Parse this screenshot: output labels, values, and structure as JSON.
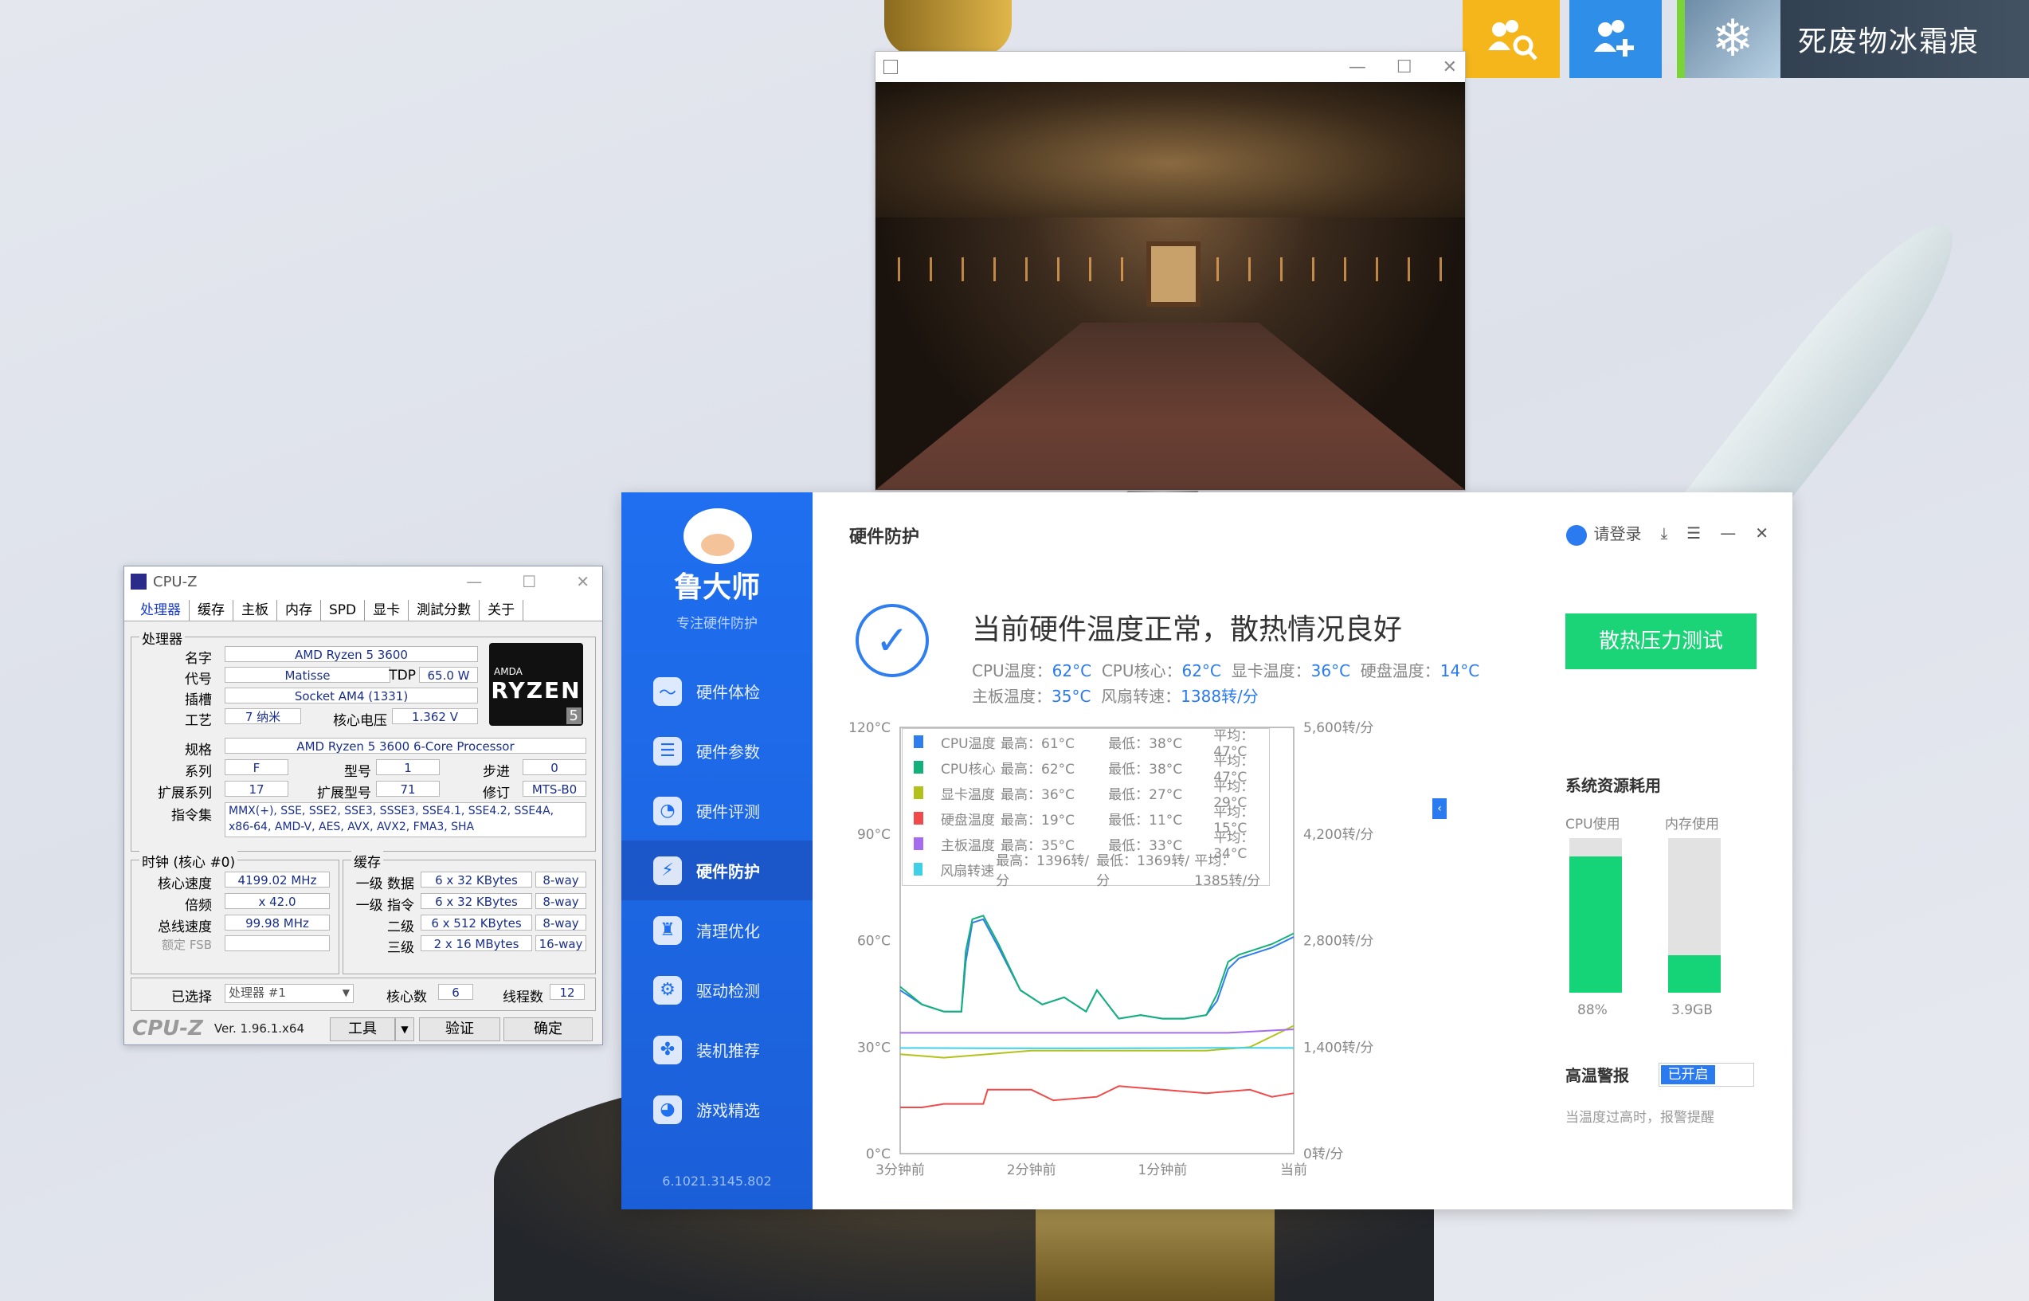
{
  "desktop": {
    "game_tile_title": "死废物冰霜痕"
  },
  "cpuz": {
    "title": "CPU-Z",
    "tabs": [
      "处理器",
      "缓存",
      "主板",
      "内存",
      "SPD",
      "显卡",
      "測試分數",
      "关于"
    ],
    "processor_group": "处理器",
    "name_label": "名字",
    "name": "AMD Ryzen 5 3600",
    "codename_label": "代号",
    "codename": "Matisse",
    "tdp_label": "TDP",
    "tdp": "65.0 W",
    "socket_label": "插槽",
    "socket": "Socket AM4 (1331)",
    "process_label": "工艺",
    "process": "7 纳米",
    "vcore_label": "核心电压",
    "vcore": "1.362 V",
    "spec_label": "规格",
    "spec": "AMD Ryzen 5 3600 6-Core Processor",
    "family_label": "系列",
    "family": "F",
    "model_label": "型号",
    "model": "1",
    "stepping_label": "步进",
    "stepping": "0",
    "extfamily_label": "扩展系列",
    "extfamily": "17",
    "extmodel_label": "扩展型号",
    "extmodel": "71",
    "revision_label": "修订",
    "revision": "MTS-B0",
    "instr_label": "指令集",
    "instr_line1": "MMX(+), SSE, SSE2, SSE3, SSSE3, SSE4.1, SSE4.2, SSE4A,",
    "instr_line2": "x86-64, AMD-V, AES, AVX, AVX2, FMA3, SHA",
    "logo_amd": "AMDA",
    "logo_ryzen": "RYZEN",
    "logo_five": "5",
    "clocks_group": "时钟 (核心 #0)",
    "core_speed_label": "核心速度",
    "core_speed": "4199.02 MHz",
    "multiplier_label": "倍频",
    "multiplier": "x 42.0",
    "bus_speed_label": "总线速度",
    "bus_speed": "99.98 MHz",
    "rated_fsb_label": "额定 FSB",
    "cache_group": "缓存",
    "l1d_label": "一级 数据",
    "l1d": "6 x 32 KBytes",
    "l1d_way": "8-way",
    "l1i_label": "一级 指令",
    "l1i": "6 x 32 KBytes",
    "l1i_way": "8-way",
    "l2_label": "二级",
    "l2": "6 x 512 KBytes",
    "l2_way": "8-way",
    "l3_label": "三级",
    "l3": "2 x 16 MBytes",
    "l3_way": "16-way",
    "selected_label": "已选择",
    "selected": "处理器 #1",
    "cores_label": "核心数",
    "cores": "6",
    "threads_label": "线程数",
    "threads": "12",
    "brand": "CPU-Z",
    "version": "Ver. 1.96.1.x64",
    "tools_button": "工具",
    "validate_button": "验证",
    "ok_button": "确定"
  },
  "ludashi": {
    "brand": "鲁大师",
    "slogan": "专注硬件防护",
    "nav": [
      "硬件体检",
      "硬件参数",
      "硬件评测",
      "硬件防护",
      "清理优化",
      "驱动检测",
      "装机推荐",
      "游戏精选"
    ],
    "active_nav": "硬件防护",
    "version": "6.1021.3145.802",
    "header": "硬件防护",
    "login": "请登录",
    "status": "当前硬件温度正常，散热情况良好",
    "temps_line1": [
      {
        "label": "CPU温度：",
        "value": "62°C"
      },
      {
        "label": "CPU核心：",
        "value": "62°C"
      },
      {
        "label": "显卡温度：",
        "value": "36°C"
      },
      {
        "label": "硬盘温度：",
        "value": "14°C"
      }
    ],
    "temps_line2": [
      {
        "label": "主板温度：",
        "value": "35°C"
      },
      {
        "label": "风扇转速：",
        "value": "1388转/分"
      }
    ],
    "stress_button": "散热压力测试",
    "legend": [
      {
        "name": "CPU温度",
        "max": "最高：61°C",
        "min": "最低：38°C",
        "avg": "平均：47°C",
        "color": "#2f7ef0"
      },
      {
        "name": "CPU核心",
        "max": "最高：62°C",
        "min": "最低：38°C",
        "avg": "平均：47°C",
        "color": "#14b07a"
      },
      {
        "name": "显卡温度",
        "max": "最高：36°C",
        "min": "最低：27°C",
        "avg": "平均：29°C",
        "color": "#b3c21a"
      },
      {
        "name": "硬盘温度",
        "max": "最高：19°C",
        "min": "最低：11°C",
        "avg": "平均：15°C",
        "color": "#f04a4a"
      },
      {
        "name": "主板温度",
        "max": "最高：35°C",
        "min": "最低：33°C",
        "avg": "平均：34°C",
        "color": "#a66cf0"
      },
      {
        "name": "风扇转速",
        "max": "最高：1396转/分",
        "min": "最低：1369转/分",
        "avg": "平均：1385转/分",
        "color": "#3fd0e8"
      }
    ],
    "sys_title": "系统资源耗用",
    "cpu_usage_label": "CPU使用",
    "mem_usage_label": "内存使用",
    "cpu_usage_value": "88%",
    "cpu_usage_fraction": 0.88,
    "mem_usage_value": "3.9GB",
    "mem_usage_fraction": 0.24,
    "alarm_title": "高温警报",
    "alarm_state": "已开启",
    "alarm_hint": "当温度过高时，报警提醒"
  },
  "chart_data": {
    "type": "line",
    "categories": [
      "3分钟前",
      "2分钟前",
      "1分钟前",
      "当前"
    ],
    "y_left_ticks": [
      "120°C",
      "90°C",
      "60°C",
      "30°C",
      "0°C"
    ],
    "y_right_ticks": [
      "5,600转/分",
      "4,200转/分",
      "2,800转/分",
      "1,400转/分",
      "0转/分"
    ],
    "ylim_left": [
      0,
      120
    ],
    "ylim_right": [
      0,
      5600
    ],
    "x_range": [
      0,
      180
    ],
    "grid": false,
    "legend_position": "top",
    "series": [
      {
        "name": "CPU温度",
        "color": "#2f7ef0",
        "axis": "left",
        "x": [
          0,
          10,
          20,
          28,
          30,
          33,
          38,
          45,
          55,
          65,
          75,
          85,
          90,
          95,
          100,
          110,
          120,
          130,
          140,
          145,
          150,
          155,
          160,
          170,
          180
        ],
        "y": [
          46,
          42,
          40,
          40,
          54,
          65,
          66,
          58,
          46,
          42,
          44,
          40,
          46,
          42,
          38,
          39,
          38,
          38,
          39,
          43,
          52,
          55,
          56,
          58,
          61
        ]
      },
      {
        "name": "CPU核心",
        "color": "#14b07a",
        "axis": "left",
        "x": [
          0,
          10,
          20,
          28,
          30,
          33,
          38,
          45,
          55,
          65,
          75,
          85,
          90,
          95,
          100,
          110,
          120,
          130,
          140,
          145,
          150,
          155,
          160,
          170,
          180
        ],
        "y": [
          47,
          42,
          40,
          40,
          57,
          66,
          67,
          59,
          46,
          42,
          44,
          40,
          46,
          42,
          38,
          39,
          38,
          38,
          39,
          45,
          54,
          56,
          57,
          59,
          62
        ]
      },
      {
        "name": "显卡温度",
        "color": "#b3c21a",
        "axis": "left",
        "x": [
          0,
          20,
          40,
          60,
          80,
          100,
          120,
          140,
          160,
          170,
          180
        ],
        "y": [
          28,
          27,
          28,
          29,
          29,
          29,
          29,
          29,
          30,
          33,
          36
        ]
      },
      {
        "name": "硬盘温度",
        "color": "#f04a4a",
        "axis": "left",
        "x": [
          0,
          10,
          20,
          38,
          40,
          60,
          70,
          90,
          100,
          120,
          140,
          160,
          170,
          180
        ],
        "y": [
          13,
          13,
          14,
          14,
          18,
          18,
          15,
          16,
          19,
          18,
          17,
          18,
          16,
          17
        ]
      },
      {
        "name": "主板温度",
        "color": "#a66cf0",
        "axis": "left",
        "x": [
          0,
          40,
          80,
          120,
          150,
          180
        ],
        "y": [
          34,
          34,
          34,
          34,
          34,
          35
        ]
      },
      {
        "name": "风扇转速",
        "color": "#3fd0e8",
        "axis": "right",
        "x": [
          0,
          40,
          80,
          120,
          150,
          180
        ],
        "y": [
          1388,
          1385,
          1383,
          1386,
          1390,
          1388
        ]
      }
    ]
  }
}
